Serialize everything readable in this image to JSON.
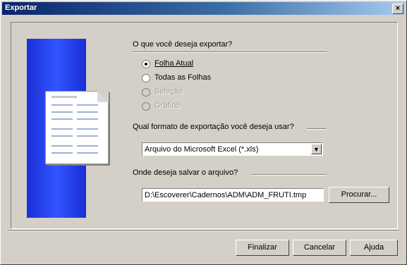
{
  "window": {
    "title": "Exportar",
    "close_label": "×"
  },
  "question_export": "O que você deseja exportar?",
  "export_options": [
    {
      "label": "Folha Atual",
      "selected": true,
      "enabled": true
    },
    {
      "label": "Todas as Folhas",
      "selected": false,
      "enabled": true
    },
    {
      "label": "Seleção",
      "selected": false,
      "enabled": false
    },
    {
      "label": "Gráfico",
      "selected": false,
      "enabled": false
    }
  ],
  "question_format": "Qual formato de exportação você deseja usar?",
  "format_select": {
    "value": "Arquivo do Microsoft Excel (*.xls)",
    "arrow": "▼"
  },
  "question_path": "Onde deseja salvar o arquivo?",
  "path_input": {
    "value": "D:\\Escoverer\\Cadernos\\ADM\\ADM_FRUTI.tmp"
  },
  "browse_button": "Procurar...",
  "footer": {
    "finish": "Finalizar",
    "cancel": "Cancelar",
    "help": "Ajuda"
  },
  "colors": {
    "titlebar_start": "#0a246a",
    "art_blue": "#3154ff",
    "face": "#d4d0c8"
  }
}
